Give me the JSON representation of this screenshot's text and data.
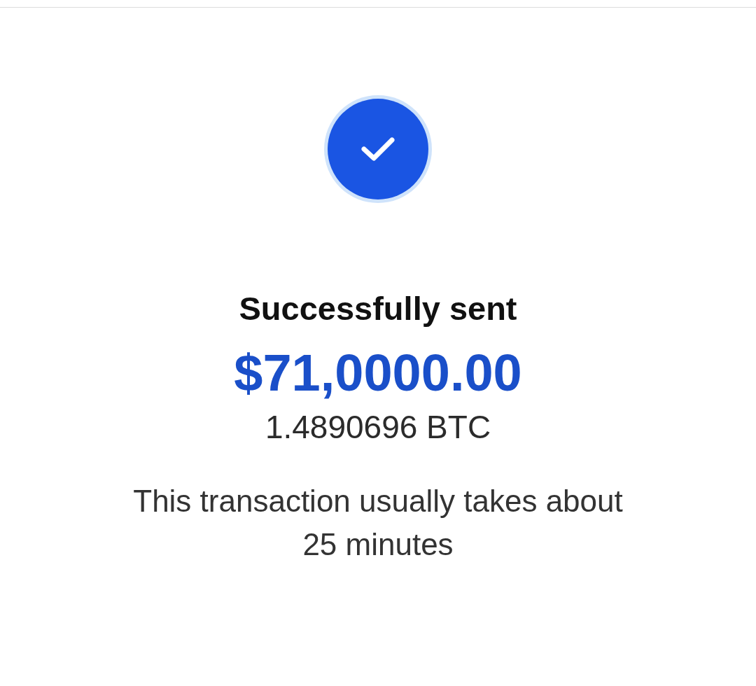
{
  "status": {
    "kind": "success"
  },
  "title": "Successfully sent",
  "amount": "$71,0000.00",
  "crypto_amount": "1.4890696 BTC",
  "note": "This transaction usually takes about 25 minutes"
}
